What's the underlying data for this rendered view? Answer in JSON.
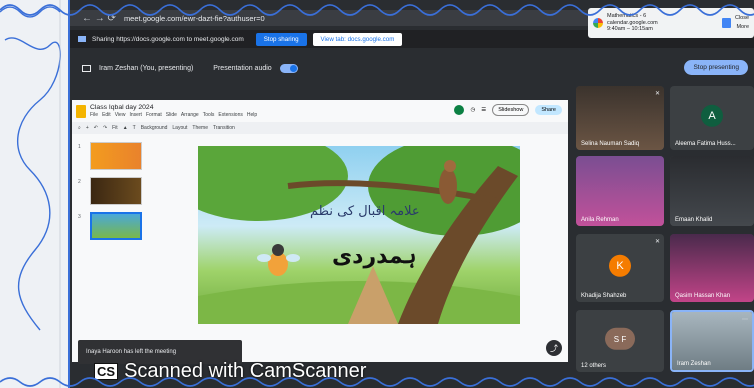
{
  "browser": {
    "url": "meet.google.com/ewr-dazt-fie?authuser=0",
    "nav_glyphs": "← → ⟳"
  },
  "sharing_bar": {
    "text": "Sharing https://docs.google.com to meet.google.com",
    "stop_label": "Stop sharing",
    "view_label": "View tab: docs.google.com"
  },
  "notification": {
    "title": "Mathematics - 6",
    "sub1": "calendar.google.com",
    "sub2": "9:40am – 10:15am",
    "close": "Close",
    "more": "More"
  },
  "presenting": {
    "user_label": "Iram Zeshan (You, presenting)",
    "audio_label": "Presentation audio",
    "stop_label": "Stop presenting"
  },
  "slides": {
    "doc_title": "Class Iqbal day 2024",
    "menu": [
      "File",
      "Edit",
      "View",
      "Insert",
      "Format",
      "Slide",
      "Arrange",
      "Tools",
      "Extensions",
      "Help"
    ],
    "toolbar": [
      "Background",
      "Layout",
      "Theme",
      "Transition"
    ],
    "fit_label": "Fit",
    "slideshow_label": "Slideshow",
    "share_label": "Share",
    "slide_numbers": [
      "1",
      "2",
      "3"
    ],
    "slide_caption": "علامہ اقبال کی نظم",
    "slide_title": "ہمدردی"
  },
  "participants": [
    {
      "name": "Selina Nauman Sadiq",
      "initial": ""
    },
    {
      "name": "Aleema Fatima Huss...",
      "initial": "A"
    },
    {
      "name": "Anila Rehman",
      "initial": ""
    },
    {
      "name": "Emaan Khalid",
      "initial": ""
    },
    {
      "name": "Khadija Shahzeb",
      "initial": "K"
    },
    {
      "name": "Qasim Hassan Khan",
      "initial": ""
    },
    {
      "name": "12 others",
      "initial": "S F"
    },
    {
      "name": "Iram Zeshan",
      "initial": ""
    }
  ],
  "toast": "Inaya Haroon has left the meeting",
  "watermark": {
    "logo": "CS",
    "text": "Scanned with CamScanner"
  },
  "colors": {
    "accent": "#1a73e8",
    "meet_bg": "#202124",
    "k_avatar": "#f57c00",
    "a_avatar": "#0f5e3f"
  }
}
